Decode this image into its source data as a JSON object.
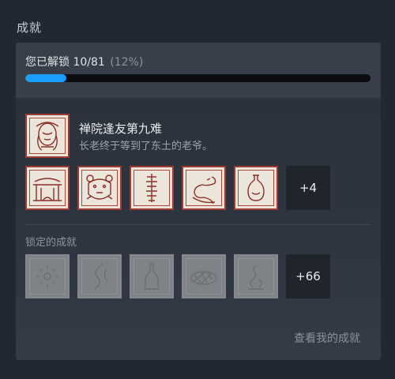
{
  "section": {
    "title": "成就"
  },
  "progress": {
    "text": "您已解锁 10/81",
    "percent_text": "(12%)",
    "value": 0.12,
    "accent_color": "#1a9fff"
  },
  "latest": {
    "title": "禅院逢友第九难",
    "description": "长老终于等到了东土的老爷。",
    "icon": "sleeping-figure-icon"
  },
  "unlocked": {
    "icons": [
      "temple-gate-icon",
      "bear-face-icon",
      "spine-scroll-icon",
      "serpent-icon",
      "gourd-vase-icon"
    ],
    "more_label": "+4"
  },
  "locked": {
    "label": "锁定的成就",
    "icons": [
      "sun-rays-icon",
      "flame-wisp-icon",
      "bottle-icon",
      "woven-basket-icon",
      "smoke-spiral-icon"
    ],
    "more_label": "+66"
  },
  "footer": {
    "view_label": "查看我的成就"
  }
}
